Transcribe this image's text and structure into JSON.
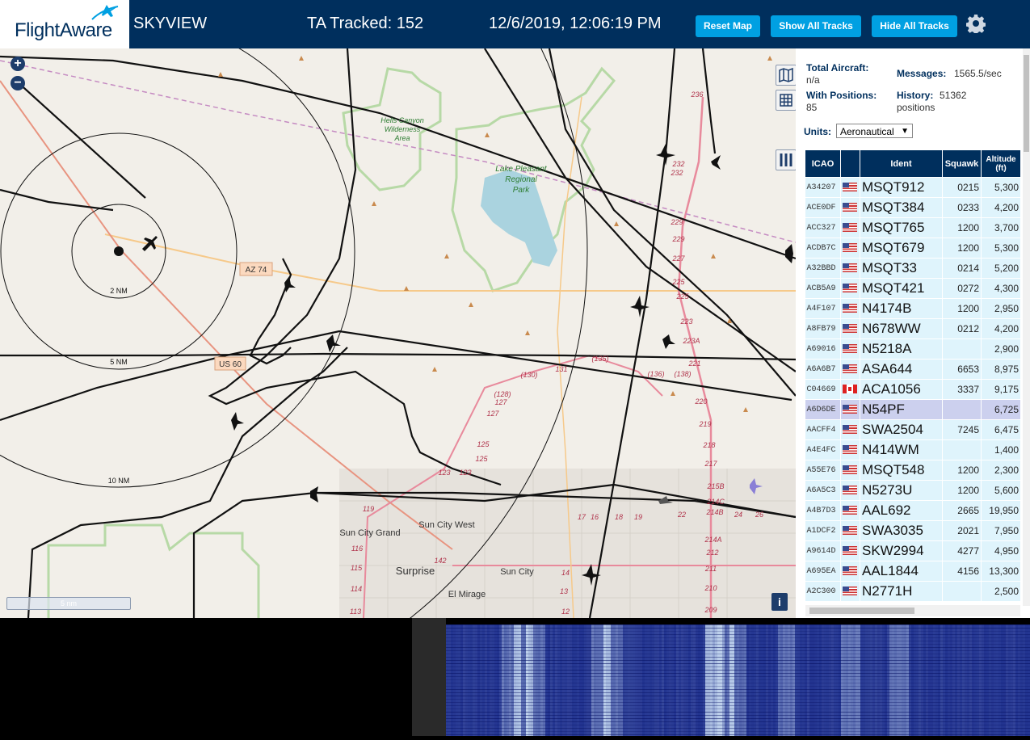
{
  "header": {
    "logo": "FlightAware",
    "site_name": "SKYVIEW",
    "tracked": "TA Tracked: 152",
    "datetime": "12/6/2019, 12:06:19 PM",
    "buttons": {
      "reset_map": "Reset Map",
      "show_all": "Show All Tracks",
      "hide_all": "Hide All Tracks"
    },
    "settings_icon": "gear-icon"
  },
  "map": {
    "zoom_in": "+",
    "zoom_out": "−",
    "scale": "5 nm",
    "info": "i",
    "range_rings": [
      "2 NM",
      "5 NM",
      "10 NM"
    ],
    "route_labels": [
      "AZ 74",
      "US 60"
    ],
    "places": [
      "Hells Canyon",
      "Wilderness",
      "Area",
      "Lake Pleasant",
      "Regional",
      "Park",
      "Sun City Grand",
      "Sun City West",
      "Surprise",
      "Sun City",
      "El Mirage"
    ],
    "highway_numbers": [
      "236",
      "232",
      "232",
      "229",
      "229",
      "227",
      "225",
      "225",
      "223",
      "223A",
      "221",
      "220",
      "219",
      "218",
      "217",
      "215B",
      "214C",
      "214B",
      "214A",
      "212",
      "211",
      "210",
      "209",
      "131",
      "(130)",
      "(135)",
      "(136)",
      "(138)",
      "(128)",
      "127",
      "127",
      "125",
      "125",
      "123",
      "123",
      "119",
      "116",
      "115",
      "114",
      "113",
      "142",
      "14",
      "13",
      "12",
      "17",
      "16",
      "18",
      "19",
      "22",
      "24",
      "26"
    ]
  },
  "sidebar": {
    "total_aircraft_label": "Total Aircraft:",
    "total_aircraft_value": "n/a",
    "with_positions_label": "With Positions:",
    "with_positions_value": "85",
    "messages_label": "Messages:",
    "messages_value": "1565.5/sec",
    "history_label": "History:",
    "history_value": "51362",
    "history_unit": "positions",
    "units_label": "Units:",
    "units_value": "Aeronautical",
    "columns": [
      "ICAO",
      "",
      "Ident",
      "Squawk",
      "Altitude (ft)"
    ],
    "rows": [
      {
        "icao": "A34207",
        "flag": "us",
        "ident": "MSQT912",
        "squawk": "0215",
        "alt": "5,300"
      },
      {
        "icao": "ACE0DF",
        "flag": "us",
        "ident": "MSQT384",
        "squawk": "0233",
        "alt": "4,200"
      },
      {
        "icao": "ACC327",
        "flag": "us",
        "ident": "MSQT765",
        "squawk": "1200",
        "alt": "3,700"
      },
      {
        "icao": "ACDB7C",
        "flag": "us",
        "ident": "MSQT679",
        "squawk": "1200",
        "alt": "5,300"
      },
      {
        "icao": "A32BBD",
        "flag": "us",
        "ident": "MSQT33",
        "squawk": "0214",
        "alt": "5,200"
      },
      {
        "icao": "ACB5A9",
        "flag": "us",
        "ident": "MSQT421",
        "squawk": "0272",
        "alt": "4,300"
      },
      {
        "icao": "A4F107",
        "flag": "us",
        "ident": "N4174B",
        "squawk": "1200",
        "alt": "2,950"
      },
      {
        "icao": "A8FB79",
        "flag": "us",
        "ident": "N678WW",
        "squawk": "0212",
        "alt": "4,200"
      },
      {
        "icao": "A69016",
        "flag": "us",
        "ident": "N5218A",
        "squawk": "",
        "alt": "2,900"
      },
      {
        "icao": "A6A6B7",
        "flag": "us",
        "ident": "ASA644",
        "squawk": "6653",
        "alt": "8,975"
      },
      {
        "icao": "C04669",
        "flag": "ca",
        "ident": "ACA1056",
        "squawk": "3337",
        "alt": "9,175"
      },
      {
        "icao": "A6D6DE",
        "flag": "us",
        "ident": "N54PF",
        "squawk": "",
        "alt": "6,725"
      },
      {
        "icao": "AACFF4",
        "flag": "us",
        "ident": "SWA2504",
        "squawk": "7245",
        "alt": "6,475"
      },
      {
        "icao": "A4E4FC",
        "flag": "us",
        "ident": "N414WM",
        "squawk": "",
        "alt": "1,400"
      },
      {
        "icao": "A55E76",
        "flag": "us",
        "ident": "MSQT548",
        "squawk": "1200",
        "alt": "2,300"
      },
      {
        "icao": "A6A5C3",
        "flag": "us",
        "ident": "N5273U",
        "squawk": "1200",
        "alt": "5,600"
      },
      {
        "icao": "A4B7D3",
        "flag": "us",
        "ident": "AAL692",
        "squawk": "2665",
        "alt": "19,950"
      },
      {
        "icao": "A1DCF2",
        "flag": "us",
        "ident": "SWA3035",
        "squawk": "2021",
        "alt": "7,950"
      },
      {
        "icao": "A9614D",
        "flag": "us",
        "ident": "SKW2994",
        "squawk": "4277",
        "alt": "4,950"
      },
      {
        "icao": "A695EA",
        "flag": "us",
        "ident": "AAL1844",
        "squawk": "4156",
        "alt": "13,300"
      },
      {
        "icao": "A2C300",
        "flag": "us",
        "ident": "N2771H",
        "squawk": "",
        "alt": "2,500"
      }
    ],
    "selected_index": 11
  },
  "colors": {
    "header_bg": "#002f5d",
    "button_bg": "#00a0e2",
    "row_bg": "#dff4fc",
    "selected_row_bg": "#ccd0ee",
    "map_bg": "#f2efe9",
    "waterfall_bg": "#0a1a7a"
  }
}
